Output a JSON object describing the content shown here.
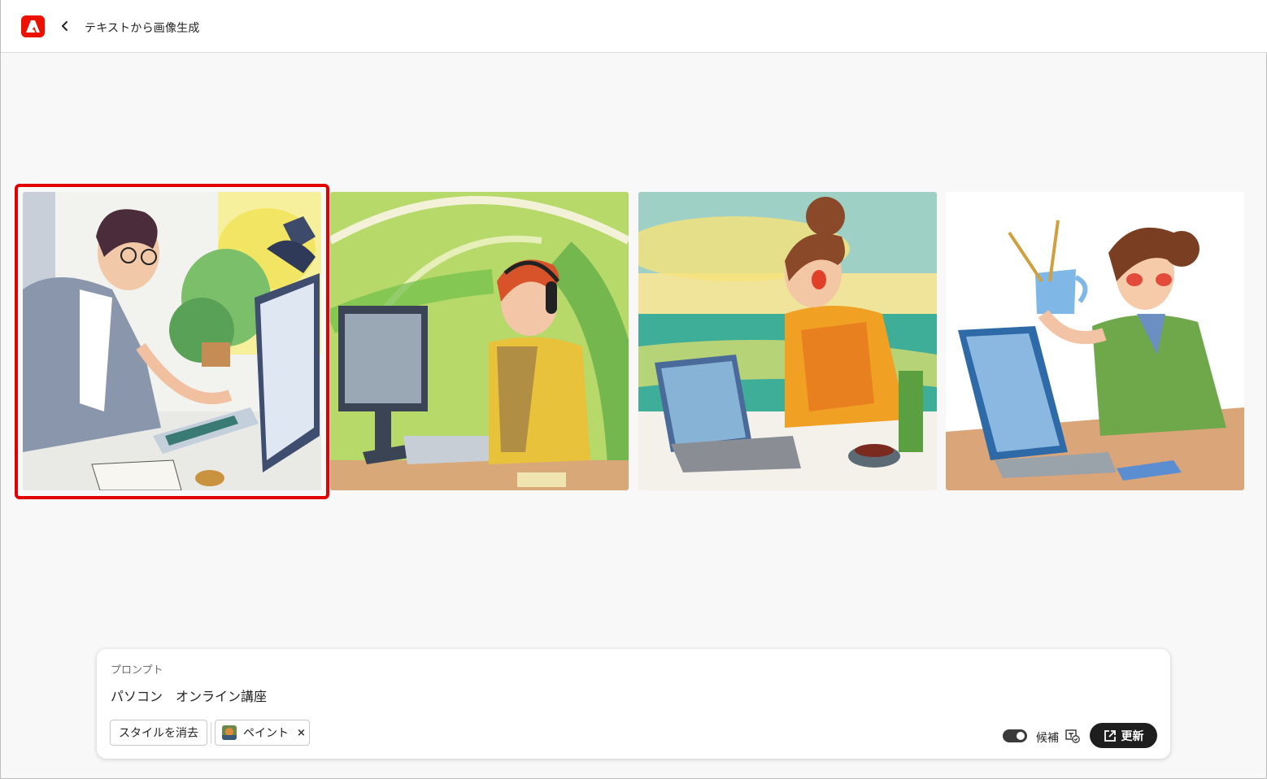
{
  "header": {
    "title": "テキストから画像生成",
    "brand_color": "#eb1000"
  },
  "gallery": {
    "selected_index": 0,
    "selection_color": "#e30000",
    "images": [
      {
        "icon": "watercolor-man-at-desktop-image"
      },
      {
        "icon": "watercolor-woman-with-headphones-image"
      },
      {
        "icon": "watercolor-woman-by-sea-image"
      },
      {
        "icon": "watercolor-woman-with-cup-image"
      }
    ]
  },
  "prompt": {
    "label": "プロンプト",
    "text": "パソコン　オンライン講座",
    "clear_style_label": "スタイルを消去",
    "style_chip_label": "ペイント",
    "style_chip_remove": "×",
    "toggle_label": "候補",
    "toggle_on": true,
    "refresh_label": "更新"
  }
}
